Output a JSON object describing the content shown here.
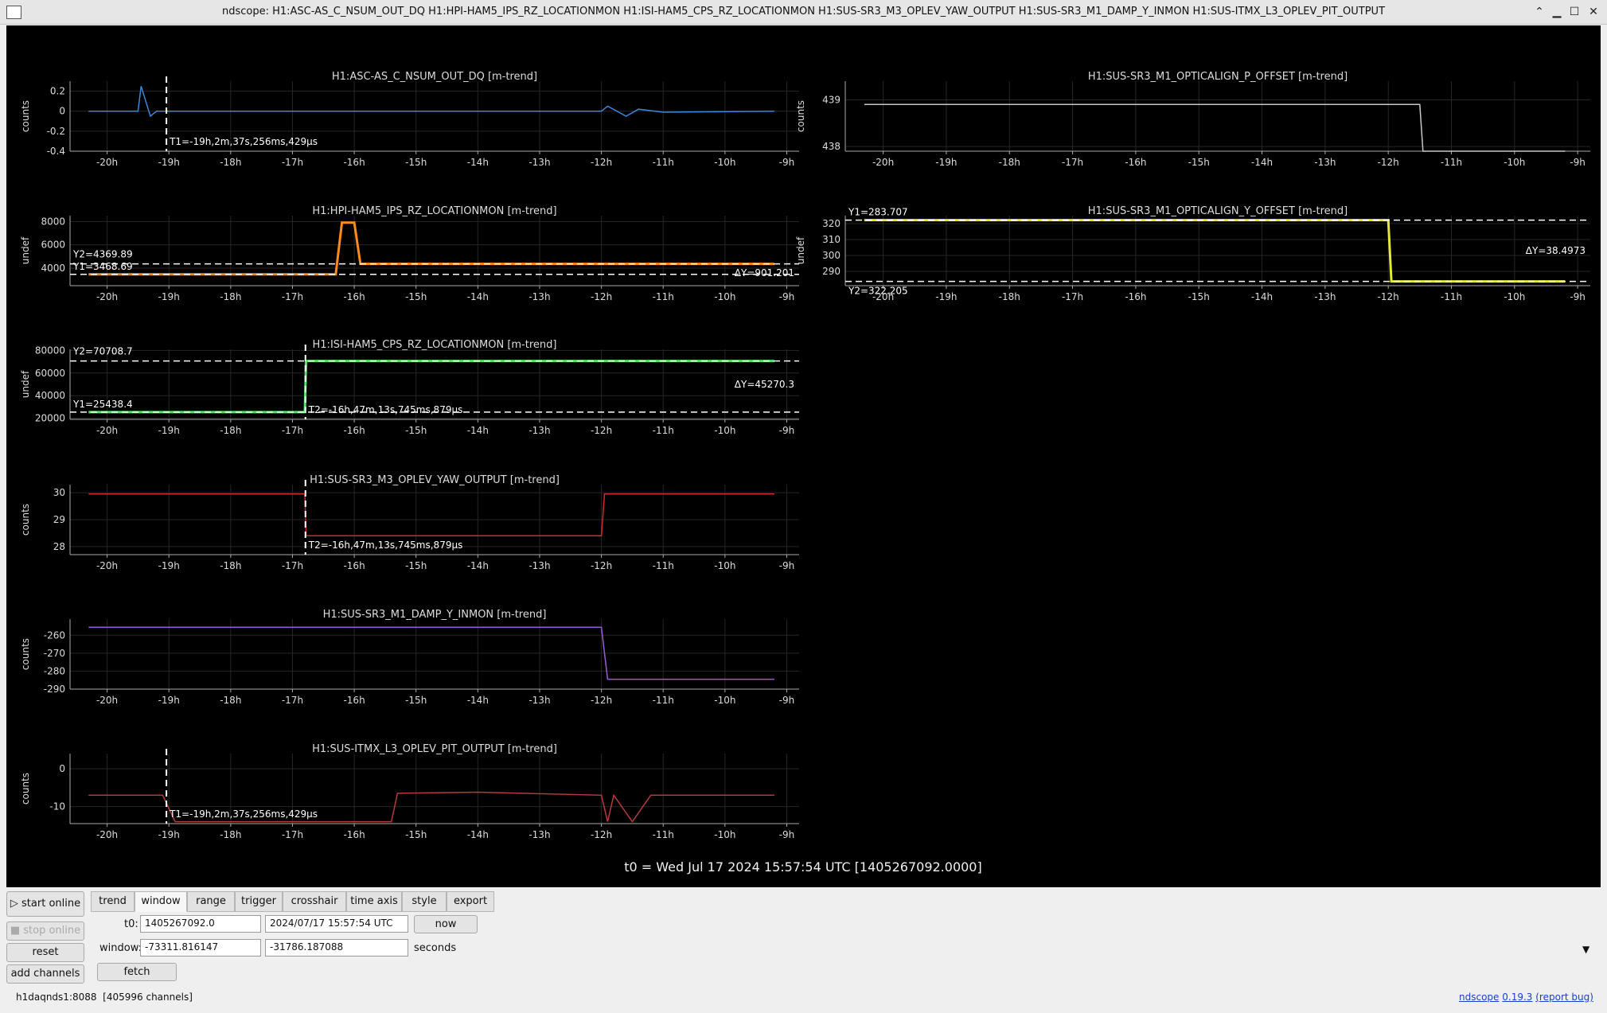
{
  "window": {
    "title": "ndscope: H1:ASC-AS_C_NSUM_OUT_DQ H1:HPI-HAM5_IPS_RZ_LOCATIONMON H1:ISI-HAM5_CPS_RZ_LOCATIONMON H1:SUS-SR3_M3_OPLEV_YAW_OUTPUT H1:SUS-SR3_M1_DAMP_Y_INMON H1:SUS-ITMX_L3_OPLEV_PIT_OUTPUT",
    "buttons": [
      "minimize-icon",
      "restore-icon",
      "maximize-icon",
      "close-icon"
    ]
  },
  "t0_label": "t0 = Wed Jul 17 2024 15:57:54 UTC [1405267092.0000]",
  "x_ticks": [
    "-20h",
    "-19h",
    "-18h",
    "-17h",
    "-16h",
    "-15h",
    "-14h",
    "-13h",
    "-12h",
    "-11h",
    "-10h",
    "-9h"
  ],
  "chart_data": [
    {
      "type": "line",
      "title": "H1:ASC-AS_C_NSUM_OUT_DQ [m-trend]",
      "ylabel": "counts",
      "color": "#3e86d6",
      "yticks": [
        "0.2",
        "0",
        "-0.2",
        "-0.4"
      ],
      "ylim": [
        -0.4,
        0.3
      ],
      "x": [
        -20.3,
        -19.5,
        -19.45,
        -19.3,
        -19.2,
        -12,
        -11.9,
        -11.6,
        -11.4,
        -11,
        -9.2
      ],
      "y": [
        0,
        0,
        0.25,
        -0.05,
        0,
        0,
        0.05,
        -0.05,
        0.02,
        -0.01,
        0
      ],
      "cursors": {
        "t1": "T1=-19h,2m,37s,256ms,429µs"
      }
    },
    {
      "type": "line",
      "title": "H1:SUS-SR3_M1_OPTICALIGN_P_OFFSET [m-trend]",
      "ylabel": "counts",
      "color": "#c8c8c8",
      "yticks": [
        "439",
        "438"
      ],
      "ylim": [
        437.9,
        439.4
      ],
      "x": [
        -20.3,
        -11.5,
        -11.45,
        -9.2
      ],
      "y": [
        438.9,
        438.9,
        437.9,
        437.9
      ]
    },
    {
      "type": "line",
      "title": "H1:HPI-HAM5_IPS_RZ_LOCATIONMON [m-trend]",
      "ylabel": "undef",
      "color": "#ff8a1e",
      "yticks": [
        "8000",
        "6000",
        "4000"
      ],
      "ylim": [
        2500,
        8500
      ],
      "x": [
        -20.3,
        -16.3,
        -16.2,
        -16.0,
        -15.9,
        -9.2
      ],
      "y": [
        3468.69,
        3468.69,
        7900,
        7900,
        4369.89,
        4369.89
      ],
      "cursors": {
        "y1": "Y1=3468.69",
        "y2": "Y2=4369.89",
        "dy": "ΔY=901.201"
      }
    },
    {
      "type": "line",
      "title": "H1:SUS-SR3_M1_OPTICALIGN_Y_OFFSET [m-trend]",
      "ylabel": "undef",
      "color": "#e4e83a",
      "yticks": [
        "320",
        "310",
        "300",
        "290"
      ],
      "ylim": [
        281,
        325
      ],
      "x": [
        -20.3,
        -12,
        -11.95,
        -9.2
      ],
      "y": [
        322.205,
        322.205,
        283.707,
        283.707
      ],
      "cursors": {
        "y1": "Y1=283.707",
        "y2": "Y2=322.205",
        "dy": "ΔY=38.4973"
      }
    },
    {
      "type": "line",
      "title": "H1:ISI-HAM5_CPS_RZ_LOCATIONMON [m-trend]",
      "ylabel": "undef",
      "color": "#5ae36a",
      "yticks": [
        "80000",
        "60000",
        "40000",
        "20000"
      ],
      "ylim": [
        19000,
        81000
      ],
      "x": [
        -20.3,
        -16.8,
        -16.78,
        -9.2
      ],
      "y": [
        25438.4,
        25438.4,
        70708.7,
        70708.7
      ],
      "cursors": {
        "y1": "Y1=25438.4",
        "y2": "Y2=70708.7",
        "dy": "ΔY=45270.3",
        "t2": "T2=-16h,47m,13s,745ms,879µs"
      }
    },
    {
      "type": "line",
      "title": "H1:SUS-SR3_M3_OPLEV_YAW_OUTPUT [m-trend]",
      "ylabel": "counts",
      "color": "#d62828",
      "yticks": [
        "30",
        "29",
        "28"
      ],
      "ylim": [
        27.7,
        30.3
      ],
      "x": [
        -20.3,
        -16.8,
        -16.78,
        -12,
        -11.95,
        -9.2
      ],
      "y": [
        29.95,
        29.95,
        28.4,
        28.4,
        29.95,
        29.95
      ],
      "cursors": {
        "t2": "T2=-16h,47m,13s,745ms,879µs"
      }
    },
    {
      "type": "line",
      "title": "H1:SUS-SR3_M1_DAMP_Y_INMON [m-trend]",
      "ylabel": "counts",
      "color": "#9a5cd6",
      "yticks": [
        "-260",
        "-270",
        "-280",
        "-290"
      ],
      "ylim": [
        -290,
        -251
      ],
      "x": [
        -20.3,
        -12,
        -11.9,
        -9.2
      ],
      "y": [
        -255.5,
        -255.5,
        -284.5,
        -284.5
      ]
    },
    {
      "type": "line",
      "title": "H1:SUS-ITMX_L3_OPLEV_PIT_OUTPUT [m-trend]",
      "ylabel": "counts",
      "color": "#b53a3a",
      "yticks": [
        "0",
        "-10"
      ],
      "ylim": [
        -14.5,
        4
      ],
      "x": [
        -20.3,
        -19.1,
        -18.9,
        -15.4,
        -15.3,
        -14,
        -12,
        -11.9,
        -11.8,
        -11.5,
        -11.2,
        -9.2
      ],
      "y": [
        -7,
        -7,
        -14,
        -14,
        -6.5,
        -6.2,
        -7,
        -14,
        -7,
        -14,
        -7,
        -7
      ],
      "cursors": {
        "t1": "T1=-19h,2m,37s,256ms,429µs"
      }
    }
  ],
  "controls": {
    "start_online": "start online",
    "stop_online": "stop online",
    "reset": "reset",
    "add_channels": "add channels",
    "tabs": [
      "trend",
      "window",
      "range",
      "trigger",
      "crosshair",
      "time axis",
      "style",
      "export"
    ],
    "t0_label": "t0:",
    "t0_gps": "1405267092.0",
    "t0_utc": "2024/07/17 15:57:54 UTC",
    "now": "now",
    "window_label": "window:",
    "window_start": "-73311.816147",
    "window_end": "-31786.187088",
    "seconds": "seconds",
    "fetch": "fetch"
  },
  "status": {
    "server": "h1daqnds1:8088",
    "channels": "[405996 channels]",
    "app": "ndscope",
    "version": "0.19.3",
    "report": "(report bug)"
  }
}
